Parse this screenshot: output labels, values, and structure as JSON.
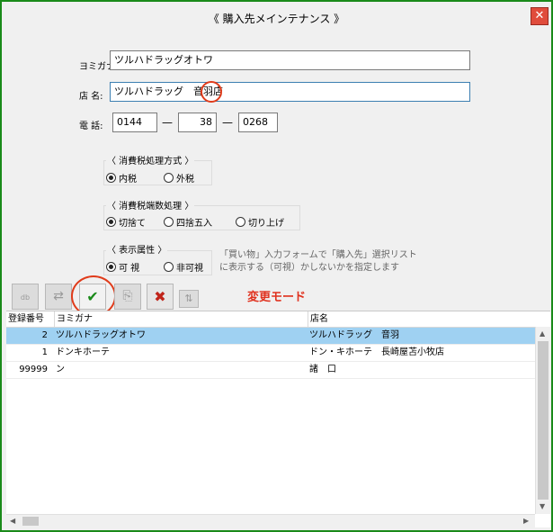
{
  "window": {
    "title": "《 購入先メインテナンス 》",
    "close_glyph": "✕"
  },
  "form": {
    "yomigana_label": "ヨミガナ:",
    "yomigana_value": "ツルハドラッグオトワ",
    "shop_name_label": "店 名:",
    "shop_name_value": "ツルハドラッグ　音羽店",
    "phone_label": "電 話:",
    "phone_1": "0144",
    "phone_2": "38",
    "phone_3": "0268",
    "phone_sep": "—"
  },
  "tax_method": {
    "title": "〈 消費税処理方式 〉",
    "options": [
      "内税",
      "外税"
    ],
    "selected": "内税"
  },
  "tax_rounding": {
    "title": "〈 消費税端数処理 〉",
    "options": [
      "切捨て",
      "四捨五入",
      "切り上げ"
    ],
    "selected": "切捨て"
  },
  "display_attr": {
    "title": "〈 表示属性 〉",
    "options": [
      "可 視",
      "非可視"
    ],
    "selected": "可 視",
    "note_line1": "「買い物」入力フォームで「購入先」選択リスト",
    "note_line2": "に表示する（可視）かしないかを指定します"
  },
  "toolbar": {
    "mode_label": "変更モード",
    "icons": [
      "new-record-icon",
      "swap-icon",
      "check-icon",
      "copy-icon",
      "delete-icon",
      "sort-icon"
    ]
  },
  "grid": {
    "columns": [
      "登録番号",
      "ヨミガナ",
      "店名"
    ],
    "rows": [
      {
        "no": "2",
        "yomi": "ツルハドラッグオトワ",
        "name": "ツルハドラッグ　音羽",
        "selected": true
      },
      {
        "no": "1",
        "yomi": "ドンキホーテ",
        "name": "ドン・キホーテ　長崎屋苫小牧店",
        "selected": false
      },
      {
        "no": "99999",
        "yomi": "ン",
        "name": "諸　口",
        "selected": false
      }
    ]
  },
  "colors": {
    "window_border": "#1a8a1a",
    "selected_row": "#9fd1f2",
    "mode_label": "#e0321f",
    "annotation_circle": "#e03b1a",
    "check_icon": "#1a8a1a",
    "delete_icon": "#c0241a"
  }
}
